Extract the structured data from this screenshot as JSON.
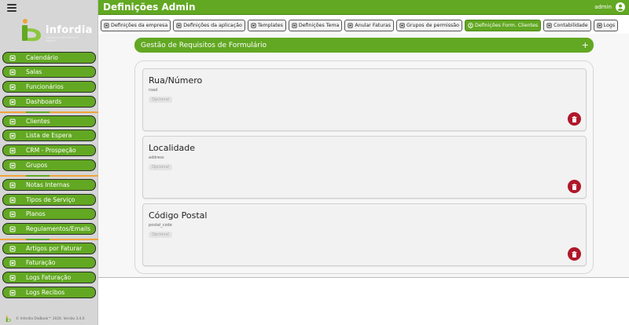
{
  "header": {
    "title": "Definições Admin",
    "user": "admin"
  },
  "brand": {
    "name": "infordia",
    "tagline": "soluções informáticas & digitais"
  },
  "sidebar": {
    "items": [
      {
        "label": "Calendário",
        "icon": "calendar-icon"
      },
      {
        "label": "Salas",
        "icon": "rooms-icon"
      },
      {
        "label": "Funcionários",
        "icon": "employees-icon"
      },
      {
        "label": "Dashboards",
        "icon": "dashboard-icon"
      },
      {
        "label": "Clientes",
        "icon": "clients-icon"
      },
      {
        "label": "Lista de Espera",
        "icon": "waitlist-icon"
      },
      {
        "label": "CRM - Prospeção",
        "icon": "crm-icon"
      },
      {
        "label": "Grupos",
        "icon": "groups-icon"
      },
      {
        "label": "Notas Internas",
        "icon": "notes-icon"
      },
      {
        "label": "Tipos de Serviço",
        "icon": "service-types-icon"
      },
      {
        "label": "Planos",
        "icon": "plans-icon"
      },
      {
        "label": "Regulamentos/Emails",
        "icon": "regulations-icon"
      },
      {
        "label": "Artigos por Faturar",
        "icon": "articles-icon"
      },
      {
        "label": "Faturação",
        "icon": "billing-icon"
      },
      {
        "label": "Logs Faturação",
        "icon": "billing-logs-icon"
      },
      {
        "label": "Logs Recibos",
        "icon": "receipt-logs-icon"
      }
    ],
    "footer": "© Infordia DiaBook™ 2026. Versão 3.4.0."
  },
  "tabs": [
    {
      "label": "Definições da empresa",
      "icon": "building-icon"
    },
    {
      "label": "Definições da aplicação",
      "icon": "app-icon"
    },
    {
      "label": "Templates",
      "icon": "file-icon"
    },
    {
      "label": "Definições Tema",
      "icon": "brush-icon"
    },
    {
      "label": "Anular Faturas",
      "icon": "invoice-icon"
    },
    {
      "label": "Grupos de permissão",
      "icon": "users-icon"
    },
    {
      "label": "Definições Form. Clientes",
      "icon": "user-circle-icon",
      "active": true
    },
    {
      "label": "Contabilidade",
      "icon": "bank-icon"
    },
    {
      "label": "Logs",
      "icon": "list-icon"
    }
  ],
  "panel": {
    "title": "Gestão de Requisitos de Formulário",
    "add": "+"
  },
  "fields": [
    {
      "name": "Rua/Número",
      "key": "road",
      "status": "Opcional"
    },
    {
      "name": "Localidade",
      "key": "address",
      "status": "Opcional"
    },
    {
      "name": "Código Postal",
      "key": "postal_code",
      "status": "Opcional"
    }
  ],
  "colors": {
    "primary": "#62a822",
    "danger": "#b0172a",
    "divider": "#f0a33a",
    "sidebar_bg": "#d6d6d6"
  }
}
